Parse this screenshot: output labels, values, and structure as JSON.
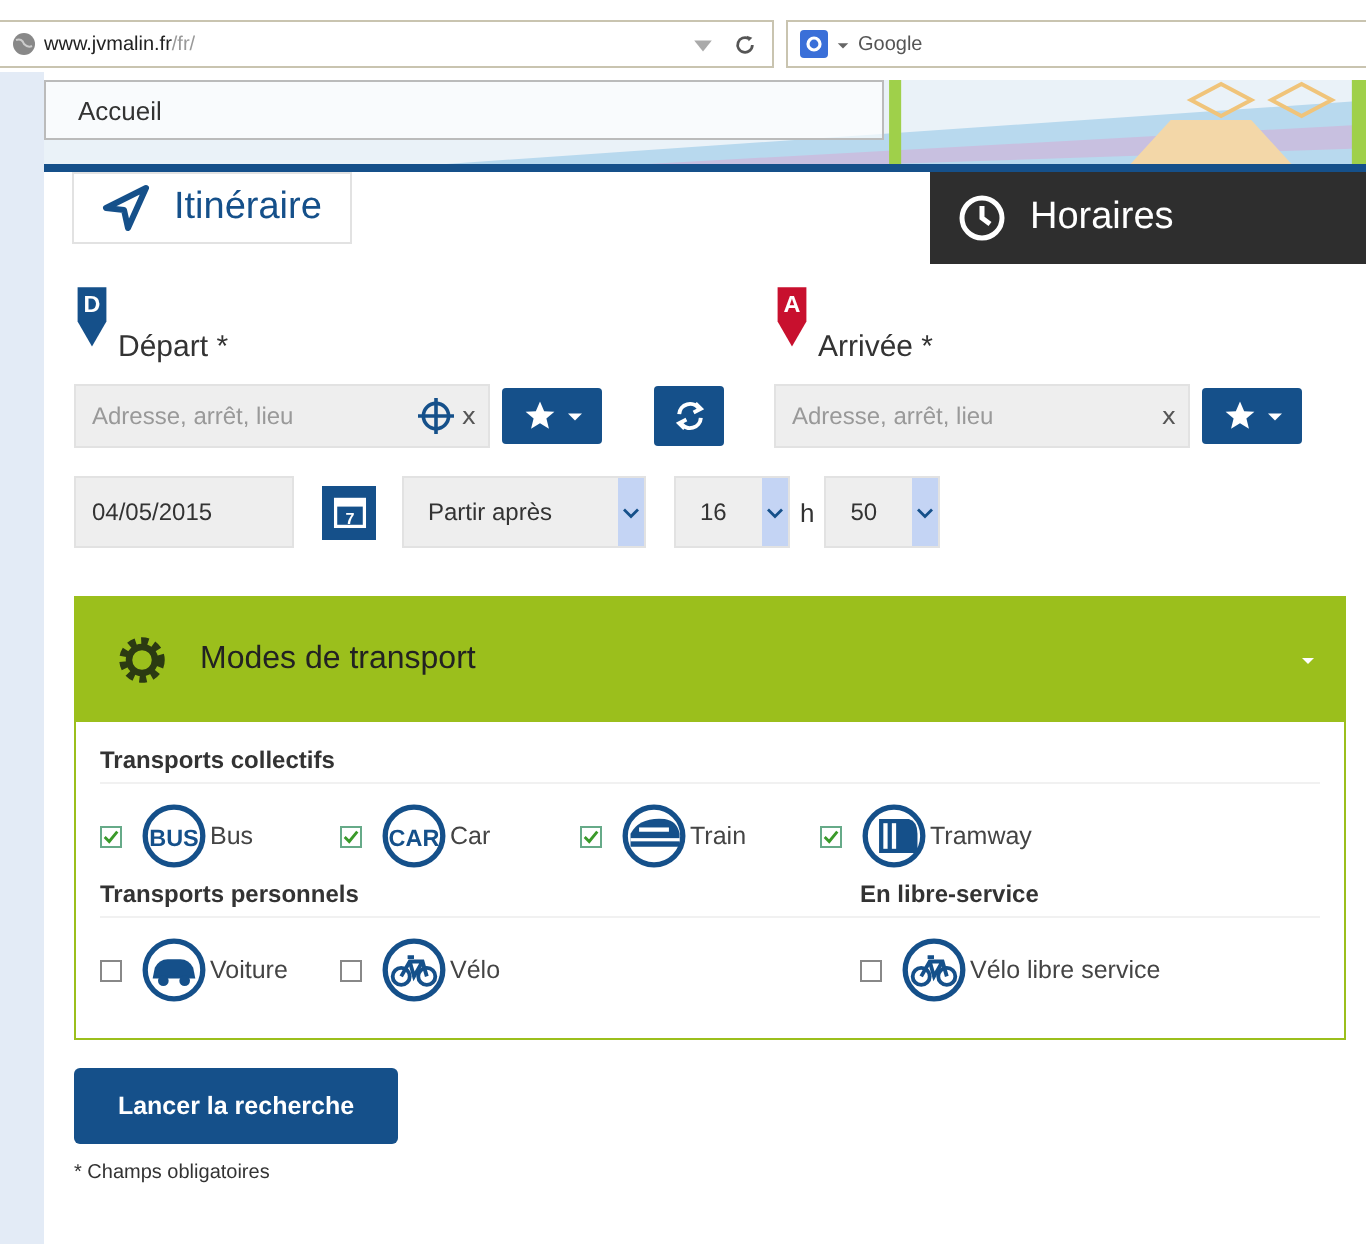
{
  "browser": {
    "url_host": "www.jvmalin.fr",
    "url_path": "/fr/",
    "search_placeholder": "Google"
  },
  "nav": {
    "home": "Accueil"
  },
  "tabs": [
    {
      "label": "Itinéraire",
      "kind": "route",
      "selected": true
    },
    {
      "label": "Horaires",
      "kind": "clock",
      "selected": false
    }
  ],
  "from": {
    "pin": "D",
    "label": "Départ *",
    "placeholder": "Adresse, arrêt, lieu",
    "clear": "x"
  },
  "to": {
    "pin": "A",
    "label": "Arrivée *",
    "placeholder": "Adresse, arrêt, lieu",
    "clear": "x"
  },
  "date": "04/05/2015",
  "calendar_day": "7",
  "when": "Partir après",
  "hour": "16",
  "hour_sep": "h",
  "minute": "50",
  "modes": {
    "title": "Modes de transport",
    "expanded": true,
    "groups": [
      {
        "title": "Transports collectifs",
        "items": [
          {
            "label": "Bus",
            "kind": "bus",
            "icon_text": "BUS",
            "checked": true
          },
          {
            "label": "Car",
            "kind": "car",
            "icon_text": "CAR",
            "checked": true
          },
          {
            "label": "Train",
            "kind": "train",
            "checked": true
          },
          {
            "label": "Tramway",
            "kind": "tram",
            "checked": true
          }
        ]
      },
      {
        "title": "Transports personnels",
        "items": [
          {
            "label": "Voiture",
            "kind": "auto",
            "checked": false
          },
          {
            "label": "Vélo",
            "kind": "bike",
            "checked": false
          }
        ]
      },
      {
        "title": "En libre-service",
        "items": [
          {
            "label": "Vélo libre service",
            "kind": "bike",
            "checked": false
          }
        ]
      }
    ]
  },
  "submit": "Lancer la recherche",
  "footnote": "* Champs obligatoires"
}
